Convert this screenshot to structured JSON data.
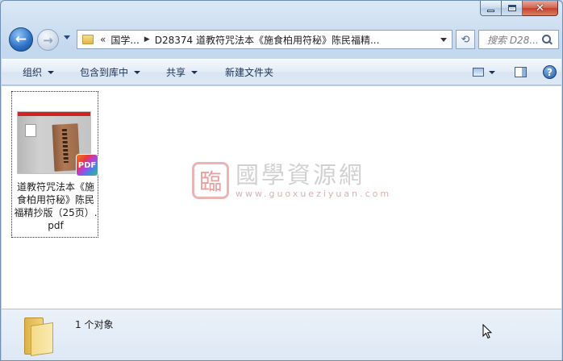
{
  "nav": {
    "back_icon": "back-arrow-icon",
    "forward_icon": "forward-arrow-icon",
    "breadcrumb": {
      "overflow": "«",
      "segments": [
        "国学...",
        "D28374 道教符咒法本《施食柏用符秘》陈民福精..."
      ]
    },
    "search_placeholder": "搜索 D28..."
  },
  "toolbar": {
    "organize": "组织",
    "include_library": "包含到库中",
    "share": "共享",
    "new_folder": "新建文件夹"
  },
  "files": [
    {
      "name": "道教符咒法本《施食柏用符秘》陈民福精抄版（25页）.pdf",
      "thumb_tag": "PDF",
      "badge": "PDF"
    }
  ],
  "watermark": {
    "seal_char": "臨",
    "title": "國學資源網",
    "url": "www.guoxueziyuan.com"
  },
  "status": {
    "object_count": "1 个对象"
  },
  "colors": {
    "accent": "#2b6fc4",
    "close_button": "#c2412a",
    "pdf_bar": "#d32222"
  }
}
